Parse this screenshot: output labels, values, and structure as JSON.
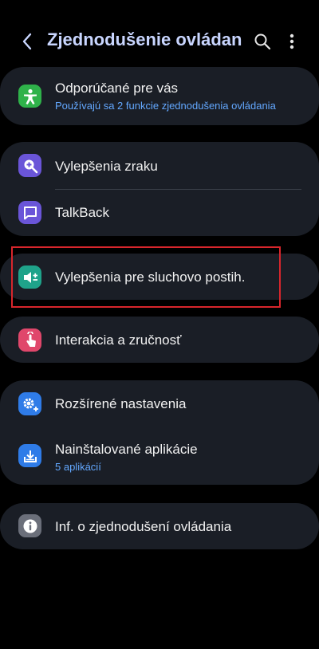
{
  "header": {
    "title": "Zjednodušenie ovládania",
    "back_icon": "chevron-left-icon",
    "search_icon": "search-icon",
    "more_icon": "more-vertical-icon"
  },
  "recommended": {
    "label": "Odporúčané pre vás",
    "sub": "Používajú sa 2 funkcie zjednodušenia ovládania",
    "icon": "accessibility-person-icon",
    "icon_color": "#2fb24a"
  },
  "vision": {
    "label": "Vylepšenia zraku",
    "icon": "magnifier-plus-icon",
    "icon_color": "#6a55d8"
  },
  "talkback": {
    "label": "TalkBack",
    "icon": "chat-bubble-icon",
    "icon_color": "#6a55d8"
  },
  "hearing": {
    "label": "Vylepšenia pre sluchovo postih.",
    "icon": "volume-plus-icon",
    "icon_color": "#1fa38a"
  },
  "interaction": {
    "label": "Interakcia a zručnosť",
    "icon": "touch-hand-icon",
    "icon_color": "#e0476b"
  },
  "advanced": {
    "label": "Rozšírené nastavenia",
    "icon": "gear-plus-icon",
    "icon_color": "#2f7ce8"
  },
  "installed": {
    "label": "Nainštalované aplikácie",
    "sub": "5 aplikácií",
    "icon": "download-box-icon",
    "icon_color": "#2f7ce8"
  },
  "info": {
    "label": "Inf. o zjednodušení ovládania",
    "icon": "info-icon",
    "icon_color": "#6b6f7a"
  },
  "colors": {
    "background": "#000000",
    "card": "#1a1e26",
    "title": "#c9d6ff",
    "link": "#63a8ff",
    "highlight": "#d7262c"
  }
}
